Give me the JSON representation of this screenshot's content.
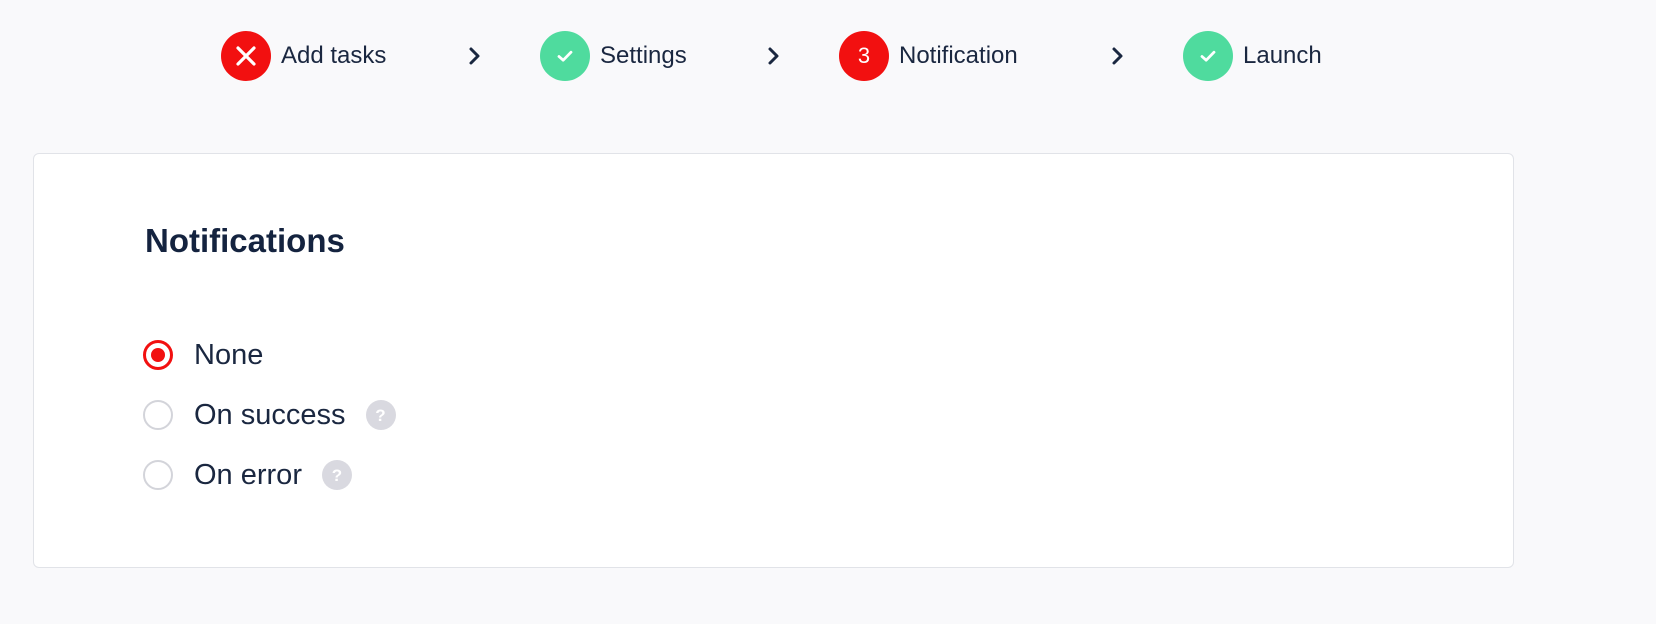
{
  "stepper": {
    "steps": [
      {
        "label": "Add tasks",
        "status": "error",
        "icon": "close-icon",
        "color": "#f21010"
      },
      {
        "label": "Settings",
        "status": "complete",
        "icon": "check-icon",
        "color": "#4fdb9e"
      },
      {
        "label": "Notification",
        "status": "current",
        "number": "3",
        "color": "#f21010"
      },
      {
        "label": "Launch",
        "status": "complete",
        "icon": "check-icon",
        "color": "#4fdb9e"
      }
    ],
    "separator_icon": "chevron-right-icon"
  },
  "notifications": {
    "title": "Notifications",
    "options": [
      {
        "label": "None",
        "selected": true,
        "has_help": false
      },
      {
        "label": "On success",
        "selected": false,
        "has_help": true,
        "help_icon": "question-icon",
        "help_glyph": "?"
      },
      {
        "label": "On error",
        "selected": false,
        "has_help": true,
        "help_icon": "question-icon",
        "help_glyph": "?"
      }
    ]
  },
  "colors": {
    "accent_red": "#f21010",
    "success_green": "#4fdb9e",
    "text_dark": "#1a2740",
    "help_grey": "#d9d9e0"
  }
}
